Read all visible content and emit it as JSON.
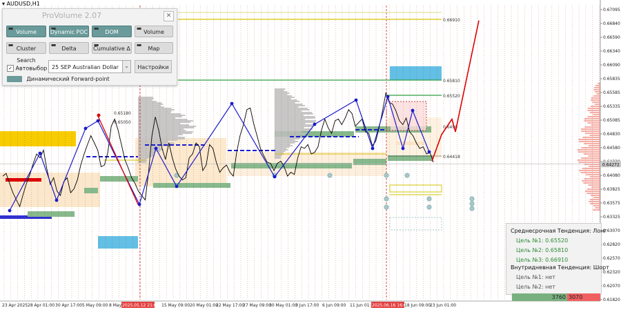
{
  "symbol": "AUDUSD,H1",
  "panel": {
    "title": "ProVolume 2.07",
    "close_glyph": "✕",
    "buttons": [
      {
        "label": "Volume Profile",
        "active": true
      },
      {
        "label": "Dynamic POC",
        "active": true
      },
      {
        "label": "DOM",
        "active": true
      },
      {
        "label": "Volume",
        "active": false
      },
      {
        "label": "Cluster Search",
        "active": false
      },
      {
        "label": "Delta",
        "active": false
      },
      {
        "label": "Cumulative Δ",
        "active": false
      },
      {
        "label": "Map",
        "active": false
      }
    ],
    "auto_select_label": "Автовыбор",
    "auto_select_checked": "✓",
    "instrument_select": "25 SEP Australian Dollar",
    "settings_label": "Настройки",
    "forward_point_label": "Динамический Forward-point"
  },
  "trend_box": {
    "mid_term": "Среднесрочная Тенденция: Лонг",
    "mid_targets": [
      "Цель №1: 0.65520",
      "Цель №2: 0.65810",
      "Цель №3: 0.66910"
    ],
    "intraday": "Внутридневная Тенденция: Шорт",
    "intraday_targets": [
      "Цель №1: нет",
      "Цель №2: нет"
    ]
  },
  "volume_bar": {
    "green_value": "3760",
    "red_value": "3070"
  },
  "colors": {
    "price_line": "#000000",
    "zigzag": "#1a1acc",
    "forecast": "#dd0000",
    "green_level": "#2e9e3e",
    "yellow_level": "#d4c400",
    "blue_zone": "#62bfe6",
    "support_zone": "#86b98c",
    "orange_zone": "#fbe5c6",
    "gold_zone": "#f7cc00",
    "grid_dotted": "#b04a2a",
    "grid_dashed_gray": "#9a9a9a",
    "right_volume_profile": "#f4a49a",
    "current_price_box": "#cccccc"
  },
  "chart_data": {
    "type": "line",
    "symbol": "AUDUSD,H1",
    "ylim": [
      0.6182,
      0.6713
    ],
    "y_ticks": [
      "0.67095",
      "0.66840",
      "0.66590",
      "0.66340",
      "0.66090",
      "0.65835",
      "0.65585",
      "0.65335",
      "0.65085",
      "0.64830",
      "0.64580",
      "0.64330",
      "0.64080",
      "0.63825",
      "0.63575",
      "0.63325",
      "0.63070",
      "0.62820",
      "0.62570",
      "0.62320",
      "0.62070",
      "0.61820"
    ],
    "x_ticks": [
      "23 Apr 2025",
      "28 Apr 01:00",
      "30 Apr 17:00",
      "5 May 09:00",
      "8 May",
      "2025.05.12 21:00",
      "15 May 09:00",
      "20 May 01:00",
      "22 May 17:00",
      "27 May 09:00",
      "30 May 01:00",
      "3 Jun 17:00",
      "6 Jun 09:00",
      "11 Jun 01:00",
      "2025.06.16 16:00",
      "18 Jun 09:00",
      "23 Jun 01:00"
    ],
    "highlighted_x_ticks": [
      "2025.05.12 21:00",
      "2025.06.16 16:00"
    ],
    "current_price": "0.64272",
    "level_labels": [
      {
        "label": "0.66910",
        "value": 0.6691
      },
      {
        "label": "0.65810",
        "value": 0.6581
      },
      {
        "label": "0.65520",
        "value": 0.6552
      },
      {
        "label": "0.64418",
        "value": 0.64418
      },
      {
        "label": "0.6490",
        "value": 0.649
      },
      {
        "label": "0.65180",
        "value": 0.6518
      },
      {
        "label": "0.65050",
        "value": 0.6505
      }
    ],
    "series": [
      {
        "name": "price",
        "values": [
          0.6405,
          0.641,
          0.6392,
          0.6375,
          0.6362,
          0.635,
          0.6372,
          0.6392,
          0.6408,
          0.6428,
          0.6445,
          0.6438,
          0.6452,
          0.6418,
          0.639,
          0.6402,
          0.6378,
          0.637,
          0.6395,
          0.6402,
          0.6375,
          0.6382,
          0.6398,
          0.6425,
          0.6445,
          0.6462,
          0.6478,
          0.6465,
          0.6452,
          0.6422,
          0.6425,
          0.6448,
          0.6495,
          0.6508,
          0.6488,
          0.6462,
          0.6435,
          0.642,
          0.6402,
          0.6392,
          0.6378,
          0.637,
          0.6362,
          0.6412,
          0.6478,
          0.6512,
          0.6488,
          0.6455,
          0.6435,
          0.6465,
          0.6438,
          0.6418,
          0.6405,
          0.6398,
          0.6402,
          0.6438,
          0.6445,
          0.6465,
          0.6458,
          0.6415,
          0.6425,
          0.6462,
          0.6455,
          0.643,
          0.6412,
          0.642,
          0.6425,
          0.6412,
          0.6405,
          0.6448,
          0.6478,
          0.6498,
          0.6525,
          0.6528,
          0.65,
          0.6478,
          0.6455,
          0.6442,
          0.643,
          0.6428,
          0.6415,
          0.6428,
          0.6432,
          0.6422,
          0.6405,
          0.6412,
          0.6408,
          0.6438,
          0.6458,
          0.6455,
          0.6462,
          0.6445,
          0.6448,
          0.6458,
          0.6488,
          0.6508,
          0.6492,
          0.6482,
          0.6505,
          0.6508,
          0.6498,
          0.651,
          0.6525,
          0.6518,
          0.6495,
          0.6502,
          0.6508,
          0.6485,
          0.6482,
          0.646,
          0.6468,
          0.6492,
          0.6522,
          0.6555,
          0.6538,
          0.6535,
          0.6522,
          0.6505,
          0.6498,
          0.651,
          0.6485,
          0.6478,
          0.6465,
          0.6455,
          0.6458,
          0.6445,
          0.6448,
          0.643
        ]
      },
      {
        "name": "forecast",
        "values": [
          0.6432,
          0.648,
          0.6508,
          0.6485,
          0.6686
        ]
      }
    ],
    "grid": true
  }
}
